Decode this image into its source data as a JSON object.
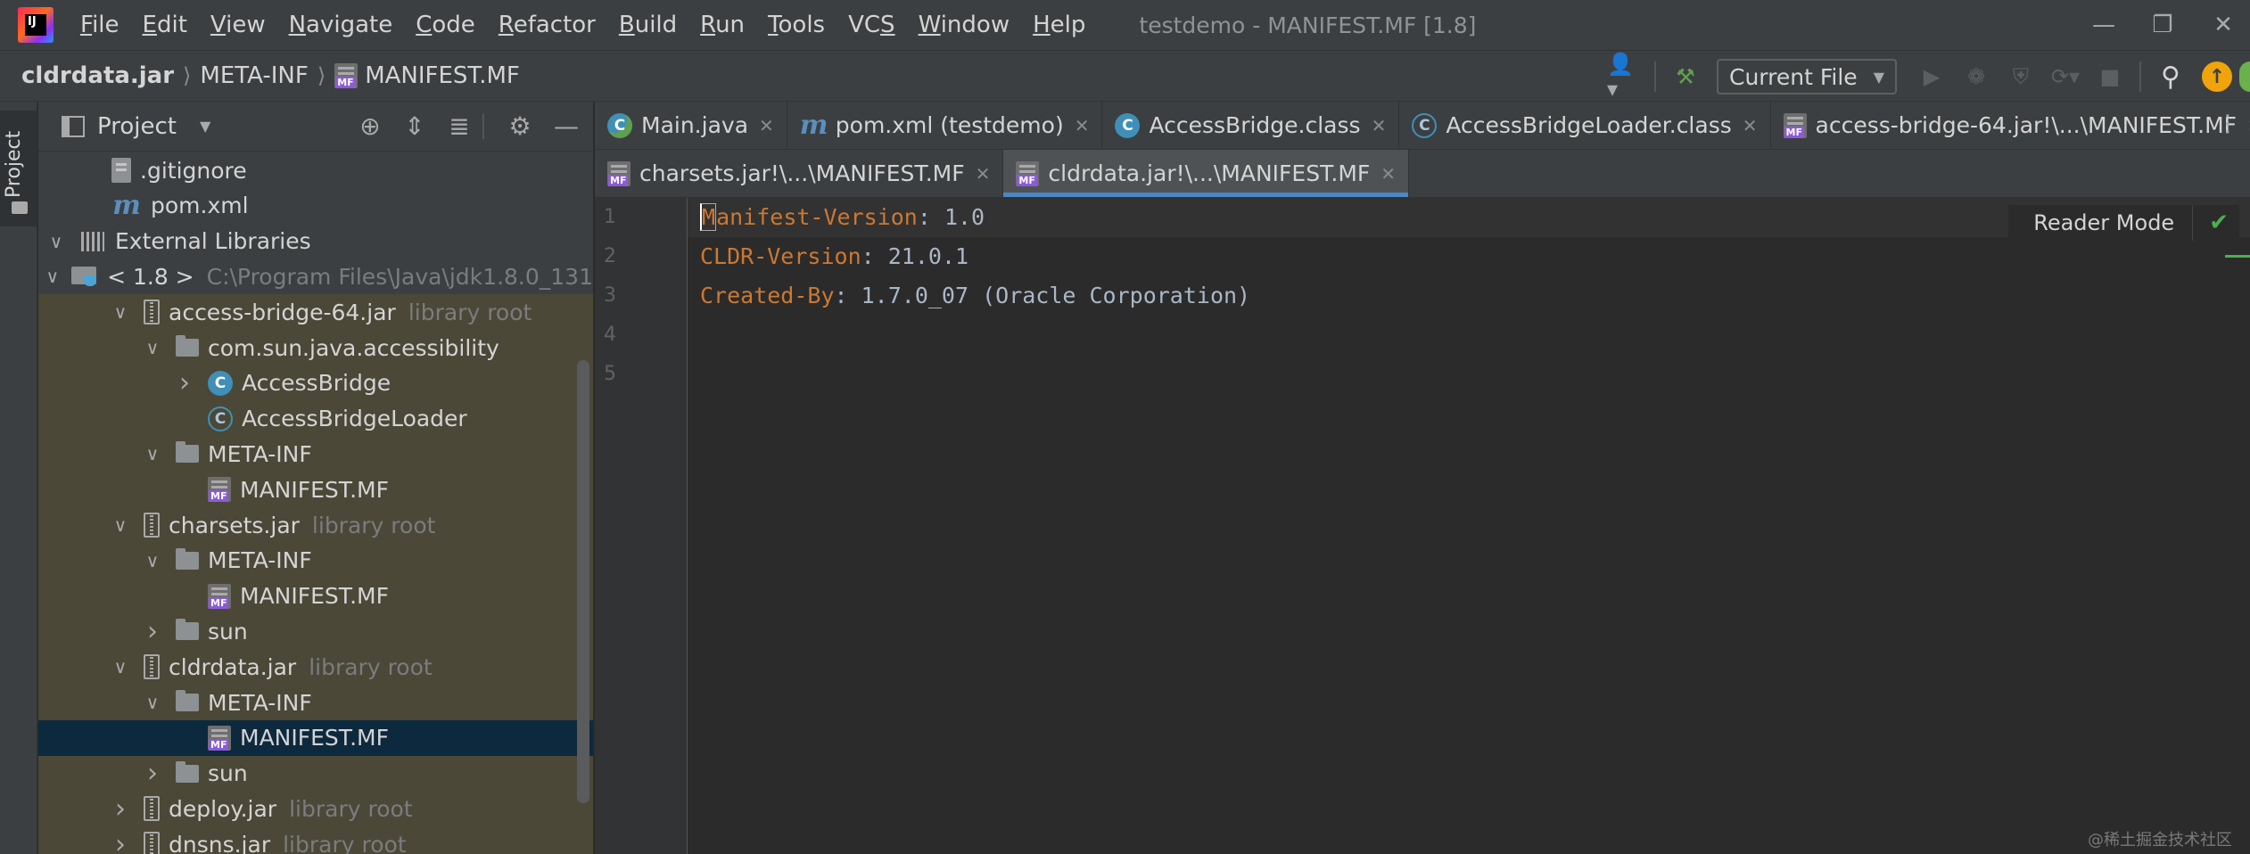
{
  "app": {
    "window_title": "testdemo - MANIFEST.MF [1.8]"
  },
  "menu": [
    {
      "label": "File",
      "mnemonic": "F",
      "rest": "ile"
    },
    {
      "label": "Edit",
      "mnemonic": "E",
      "rest": "dit"
    },
    {
      "label": "View",
      "mnemonic": "V",
      "rest": "iew"
    },
    {
      "label": "Navigate",
      "mnemonic": "N",
      "rest": "avigate"
    },
    {
      "label": "Code",
      "mnemonic": "C",
      "rest": "ode"
    },
    {
      "label": "Refactor",
      "mnemonic": "R",
      "rest": "efactor"
    },
    {
      "label": "Build",
      "mnemonic": "B",
      "rest": "uild"
    },
    {
      "label": "Run",
      "mnemonic": "R",
      "rest": "un"
    },
    {
      "label": "Tools",
      "mnemonic": "T",
      "rest": "ools"
    },
    {
      "label": "VCS",
      "mnemonic": "S",
      "prefix": "VC"
    },
    {
      "label": "Window",
      "mnemonic": "W",
      "rest": "indow"
    },
    {
      "label": "Help",
      "mnemonic": "H",
      "rest": "elp"
    }
  ],
  "breadcrumb": [
    "cldrdata.jar",
    "META-INF",
    "MANIFEST.MF"
  ],
  "run_config": {
    "label": "Current File"
  },
  "project_panel": {
    "title": "Project",
    "tree": [
      {
        "label": ".gitignore",
        "hint": "",
        "icon": "file",
        "expand": "none",
        "indent": 1,
        "lib": false,
        "selected": false
      },
      {
        "label": "pom.xml",
        "hint": "",
        "icon": "maven",
        "expand": "none",
        "indent": 1,
        "lib": false,
        "selected": false
      },
      {
        "label": "External Libraries",
        "hint": "",
        "icon": "library",
        "expand": "open",
        "indent": 0,
        "lib": false,
        "selected": false
      },
      {
        "label": "< 1.8 >",
        "hint": "C:\\Program Files\\Java\\jdk1.8.0_131",
        "icon": "jdk",
        "expand": "open",
        "indent": 1,
        "lib": false,
        "selected": false
      },
      {
        "label": "access-bridge-64.jar",
        "hint": "library root",
        "icon": "jar",
        "expand": "open",
        "indent": 2,
        "lib": true,
        "selected": false
      },
      {
        "label": "com.sun.java.accessibility",
        "hint": "",
        "icon": "folder",
        "expand": "open",
        "indent": 3,
        "lib": true,
        "selected": false
      },
      {
        "label": "AccessBridge",
        "hint": "",
        "icon": "class",
        "expand": "closed",
        "indent": 4,
        "lib": true,
        "selected": false
      },
      {
        "label": "AccessBridgeLoader",
        "hint": "",
        "icon": "class-ghost",
        "expand": "none",
        "indent": 4,
        "lib": true,
        "selected": false
      },
      {
        "label": "META-INF",
        "hint": "",
        "icon": "folder",
        "expand": "open",
        "indent": 3,
        "lib": true,
        "selected": false
      },
      {
        "label": "MANIFEST.MF",
        "hint": "",
        "icon": "mf",
        "expand": "none",
        "indent": 4,
        "lib": true,
        "selected": false
      },
      {
        "label": "charsets.jar",
        "hint": "library root",
        "icon": "jar",
        "expand": "open",
        "indent": 2,
        "lib": true,
        "selected": false
      },
      {
        "label": "META-INF",
        "hint": "",
        "icon": "folder",
        "expand": "open",
        "indent": 3,
        "lib": true,
        "selected": false
      },
      {
        "label": "MANIFEST.MF",
        "hint": "",
        "icon": "mf",
        "expand": "none",
        "indent": 4,
        "lib": true,
        "selected": false
      },
      {
        "label": "sun",
        "hint": "",
        "icon": "folder",
        "expand": "closed",
        "indent": 3,
        "lib": true,
        "selected": false
      },
      {
        "label": "cldrdata.jar",
        "hint": "library root",
        "icon": "jar",
        "expand": "open",
        "indent": 2,
        "lib": true,
        "selected": false
      },
      {
        "label": "META-INF",
        "hint": "",
        "icon": "folder",
        "expand": "open",
        "indent": 3,
        "lib": true,
        "selected": false
      },
      {
        "label": "MANIFEST.MF",
        "hint": "",
        "icon": "mf",
        "expand": "none",
        "indent": 4,
        "lib": true,
        "selected": true
      },
      {
        "label": "sun",
        "hint": "",
        "icon": "folder",
        "expand": "closed",
        "indent": 3,
        "lib": true,
        "selected": false
      },
      {
        "label": "deploy.jar",
        "hint": "library root",
        "icon": "jar",
        "expand": "closed",
        "indent": 2,
        "lib": true,
        "selected": false
      },
      {
        "label": "dnsns.jar",
        "hint": "library root",
        "icon": "jar",
        "expand": "closed",
        "indent": 2,
        "lib": true,
        "selected": false
      }
    ]
  },
  "tabs_row1": [
    {
      "label": "Main.java",
      "icon": "class-run",
      "active": false
    },
    {
      "label": "pom.xml (testdemo)",
      "icon": "maven",
      "active": false
    },
    {
      "label": "AccessBridge.class",
      "icon": "class",
      "active": false
    },
    {
      "label": "AccessBridgeLoader.class",
      "icon": "class-ghost",
      "active": false
    },
    {
      "label": "access-bridge-64.jar!\\...\\MANIFEST.MF",
      "icon": "mf",
      "active": false
    }
  ],
  "tabs_row2": [
    {
      "label": "charsets.jar!\\...\\MANIFEST.MF",
      "icon": "mf",
      "active": false
    },
    {
      "label": "cldrdata.jar!\\...\\MANIFEST.MF",
      "icon": "mf",
      "active": true
    }
  ],
  "editor": {
    "line_numbers": [
      "1",
      "2",
      "3",
      "4",
      "5"
    ],
    "lines": [
      {
        "key": "Manifest-Version",
        "sep": ": ",
        "value": "1.0"
      },
      {
        "key": "CLDR-Version",
        "sep": ": ",
        "value": "21.0.1"
      },
      {
        "key": "Created-By",
        "sep": ": ",
        "value": "1.7.0_07 (Oracle Corporation)"
      },
      {
        "key": "",
        "sep": "",
        "value": ""
      },
      {
        "key": "",
        "sep": "",
        "value": ""
      }
    ],
    "reader_mode_label": "Reader Mode"
  },
  "side_strip": {
    "project_label": "Project"
  },
  "watermark": "@稀土掘金技术社区",
  "colors": {
    "accent": "#4a88c7",
    "key": "#cc7832",
    "value": "#a9b7c6",
    "library_row": "#4b4838",
    "selection": "#0d293e"
  }
}
